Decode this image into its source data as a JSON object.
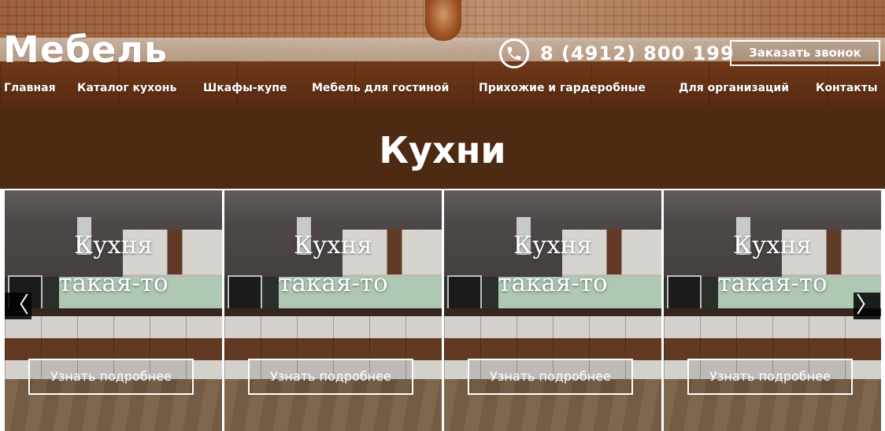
{
  "header": {
    "logo": "Мебель",
    "phone": "8 (4912) 800 199",
    "phone_icon": "phone-icon",
    "callback_button": "Заказать звонок",
    "nav": [
      "Главная",
      "Каталог кухонь",
      "Шкафы-купе",
      "Мебель для гостиной",
      "Прихожие и гардеробные",
      "Для организаций",
      "Контакты"
    ]
  },
  "section": {
    "title": "Кухни"
  },
  "slider": {
    "prev_icon": "chevron-left-icon",
    "next_icon": "chevron-right-icon",
    "prev_glyph": "〈",
    "next_glyph": "〉",
    "cards": [
      {
        "title_line1": "Кухня",
        "title_line2": "такая-то",
        "button": "Узнать подробнее"
      },
      {
        "title_line1": "Кухня",
        "title_line2": "такая-то",
        "button": "Узнать подробнее"
      },
      {
        "title_line1": "Кухня",
        "title_line2": "такая-то",
        "button": "Узнать подробнее"
      },
      {
        "title_line1": "Кухня",
        "title_line2": "такая-то",
        "button": "Узнать подробнее"
      }
    ]
  },
  "colors": {
    "title_band": "#4d2a12",
    "text": "#ffffff"
  }
}
